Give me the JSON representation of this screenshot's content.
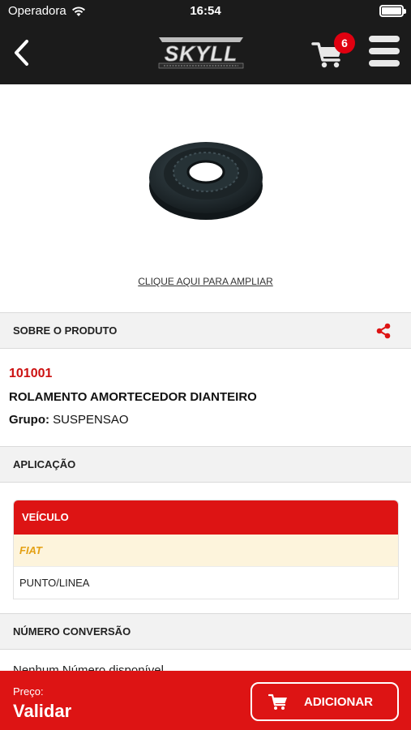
{
  "status_bar": {
    "carrier": "Operadora",
    "time": "16:54"
  },
  "nav": {
    "logo_text": "SKYLL",
    "logo_tagline": "DISTRIBUIDORA DE AUTO PEÇAS",
    "cart_count": "6"
  },
  "product": {
    "zoom_link": "CLIQUE AQUI PARA AMPLIAR",
    "about_header": "SOBRE O PRODUTO",
    "code": "101001",
    "name": "ROLAMENTO AMORTECEDOR DIANTEIRO",
    "group_label": "Grupo:",
    "group_value": "SUSPENSAO"
  },
  "application": {
    "header": "APLICAÇÃO",
    "table_header": "VEÍCULO",
    "brand": "FIAT",
    "model": "PUNTO/LINEA"
  },
  "conversion": {
    "header": "NÚMERO CONVERSÃO",
    "text": "Nenhum Número disponível"
  },
  "bottom": {
    "price_label": "Preço:",
    "price_value": "Validar",
    "add_button": "ADICIONAR"
  },
  "colors": {
    "brand_red": "#dd1414",
    "nav_dark": "#1b1b1b",
    "brand_yellow": "#e4a013"
  }
}
